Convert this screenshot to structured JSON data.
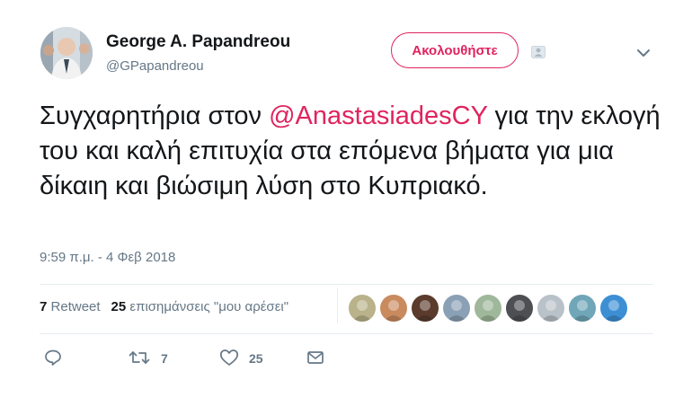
{
  "author": {
    "name": "George A. Papandreou",
    "handle": "@GPapandreou"
  },
  "follow_button": {
    "label": "Ακολουθήστε",
    "color": "#e0245e"
  },
  "tweet": {
    "text_before": "Συγχαρητήρια στον ",
    "mention": "@AnastasiadesCY",
    "text_after": " για την εκλογή του και καλή επιτυχία στα επόμενα βήματα για μια δίκαιη και βιώσιμη λύση στο Κυπριακό.",
    "timestamp": "9:59 π.μ. - 4 Φεβ 2018"
  },
  "stats": {
    "retweet_count": "7",
    "retweet_label": "Retweet",
    "like_count": "25",
    "like_label": "επισημάνσεις \"μου αρέσει\""
  },
  "likers": [
    {
      "icon": "seal-avatar",
      "color": "#b9b28a"
    },
    {
      "icon": "woman-avatar",
      "color": "#c98a5e"
    },
    {
      "icon": "man-avatar",
      "color": "#5a3b2c"
    },
    {
      "icon": "default-avatar",
      "color": "#8aa0b4"
    },
    {
      "icon": "figures-avatar",
      "color": "#9fb79a"
    },
    {
      "icon": "man-dark-avatar",
      "color": "#4d4f52"
    },
    {
      "icon": "man-grey-avatar",
      "color": "#b9c2c8"
    },
    {
      "icon": "landscape-avatar",
      "color": "#6fa6b8"
    },
    {
      "icon": "beach-avatar",
      "color": "#3d8fd4"
    }
  ],
  "actions": {
    "reply_icon": "reply-icon",
    "retweet_icon": "retweet-icon",
    "retweet_count": "7",
    "like_icon": "heart-icon",
    "like_count": "25",
    "message_icon": "envelope-icon"
  }
}
